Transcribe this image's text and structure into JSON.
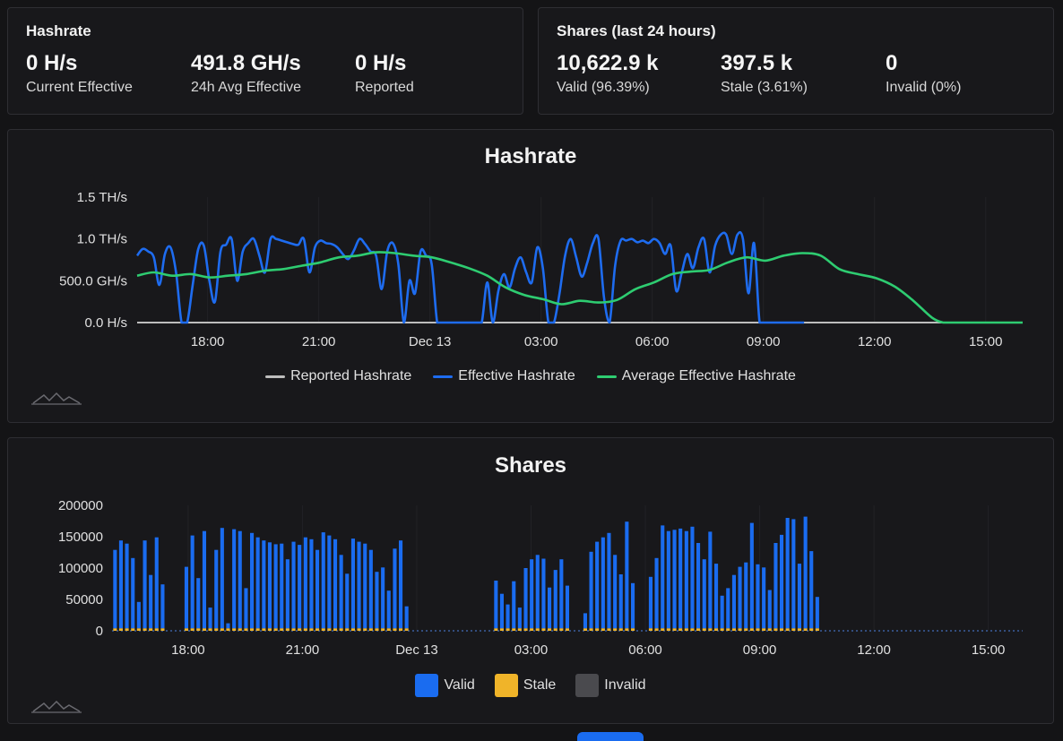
{
  "hashrate_card": {
    "title": "Hashrate",
    "stats": [
      {
        "value": "0 H/s",
        "label": "Current Effective"
      },
      {
        "value": "491.8 GH/s",
        "label": "24h Avg Effective"
      },
      {
        "value": "0 H/s",
        "label": "Reported"
      }
    ]
  },
  "shares_card": {
    "title": "Shares (last 24 hours)",
    "stats": [
      {
        "value": "10,622.9 k",
        "label": "Valid (96.39%)"
      },
      {
        "value": "397.5 k",
        "label": "Stale (3.61%)"
      },
      {
        "value": "0",
        "label": "Invalid (0%)"
      }
    ]
  },
  "colors": {
    "effective": "#1e6cf0",
    "average": "#2ecc71",
    "reported": "#bdbdbd",
    "valid": "#1a6cf0",
    "stale": "#f0b429",
    "invalid": "#4a4a4e"
  },
  "icons": {
    "watermark": "chart-logo-icon"
  },
  "chart_data": [
    {
      "type": "line",
      "title": "Hashrate",
      "x_ticks": [
        "18:00",
        "21:00",
        "Dec 13",
        "03:00",
        "06:00",
        "09:00",
        "12:00",
        "15:00"
      ],
      "x_tick_hours": [
        18,
        21,
        24,
        27,
        30,
        33,
        36,
        39
      ],
      "x_range_hours": [
        16.05,
        39.95
      ],
      "y_ticks": [
        "0.0 H/s",
        "500.0 GH/s",
        "1.0 TH/s",
        "1.5 TH/s"
      ],
      "y_tick_values_ghs": [
        0,
        500,
        1000,
        1500
      ],
      "ylim_ghs": [
        0,
        1500
      ],
      "grid": true,
      "legend": "bottom",
      "series": [
        {
          "name": "Reported Hashrate",
          "color_key": "reported",
          "hours": [
            16.05,
            39.95
          ],
          "values_ghs": [
            0,
            0
          ]
        },
        {
          "name": "Effective Hashrate",
          "color_key": "effective",
          "hours": [
            16.05,
            16.2,
            16.35,
            16.5,
            16.65,
            16.8,
            16.95,
            17.1,
            17.25,
            17.4,
            17.55,
            17.7,
            17.85,
            18.0,
            18.15,
            18.3,
            18.45,
            18.6,
            18.75,
            18.9,
            19.05,
            19.2,
            19.35,
            19.5,
            19.65,
            19.8,
            19.95,
            20.1,
            20.25,
            20.4,
            20.55,
            20.7,
            20.85,
            21.0,
            21.15,
            21.3,
            21.45,
            21.6,
            21.75,
            21.9,
            22.05,
            22.2,
            22.35,
            22.5,
            22.65,
            22.8,
            22.95,
            23.1,
            23.25,
            23.4,
            23.55,
            23.7,
            23.85,
            24.0,
            24.15,
            24.3,
            24.45,
            24.6,
            24.75,
            24.9,
            25.05,
            25.2,
            25.35,
            25.5,
            25.65,
            25.8,
            25.95,
            26.1,
            26.25,
            26.4,
            26.55,
            26.7,
            26.85,
            27.0,
            27.15,
            27.3,
            27.45,
            27.6,
            27.75,
            27.9,
            28.05,
            28.2,
            28.35,
            28.5,
            28.65,
            28.8,
            28.95,
            29.1,
            29.25,
            29.4,
            29.55,
            29.7,
            29.85,
            30.0,
            30.15,
            30.3,
            30.45,
            30.6,
            30.75,
            30.9,
            31.05,
            31.2,
            31.35,
            31.5,
            31.65,
            31.8,
            31.95,
            32.1,
            32.25,
            32.4,
            32.55,
            32.7,
            32.85,
            33.0,
            33.15,
            33.3,
            33.45,
            33.6,
            33.75,
            33.9,
            34.05,
            34.2,
            34.35,
            34.5,
            35.0,
            36.0,
            37.0,
            38.0,
            39.0,
            39.95
          ],
          "values_ghs": [
            800,
            880,
            850,
            780,
            450,
            820,
            900,
            600,
            0,
            0,
            450,
            880,
            920,
            500,
            250,
            850,
            930,
            1000,
            500,
            850,
            950,
            1000,
            800,
            600,
            1000,
            1000,
            980,
            960,
            940,
            930,
            1000,
            600,
            900,
            980,
            950,
            940,
            900,
            820,
            760,
            860,
            1000,
            940,
            850,
            800,
            400,
            850,
            950,
            700,
            0,
            500,
            350,
            850,
            800,
            700,
            0,
            0,
            0,
            0,
            0,
            0,
            0,
            0,
            0,
            480,
            0,
            380,
            580,
            420,
            650,
            780,
            600,
            480,
            900,
            650,
            0,
            0,
            350,
            800,
            1000,
            780,
            550,
            720,
            950,
            1000,
            300,
            0,
            680,
            980,
            980,
            1000,
            960,
            980,
            950,
            1000,
            950,
            820,
            920,
            380,
            600,
            820,
            650,
            900,
            1000,
            600,
            920,
            1050,
            1050,
            820,
            1050,
            1000,
            350,
            950,
            0,
            0,
            0,
            0,
            0,
            0,
            0,
            0,
            0,
            0
          ]
        },
        {
          "name": "Average Effective Hashrate",
          "color_key": "average",
          "hours": [
            16.05,
            16.5,
            17.0,
            17.5,
            18.0,
            18.5,
            19.0,
            19.5,
            20.0,
            20.5,
            21.0,
            21.5,
            22.0,
            22.5,
            23.0,
            23.5,
            24.0,
            24.5,
            25.0,
            25.5,
            26.0,
            26.5,
            27.0,
            27.5,
            28.0,
            28.5,
            29.0,
            29.5,
            30.0,
            30.5,
            31.0,
            31.5,
            32.0,
            32.5,
            33.0,
            33.5,
            34.0,
            34.5,
            35.0,
            35.5,
            36.0,
            36.5,
            37.0,
            37.5,
            37.8,
            38.0,
            38.5,
            39.0,
            39.95
          ],
          "values_ghs": [
            560,
            600,
            560,
            580,
            540,
            560,
            580,
            620,
            640,
            680,
            720,
            780,
            800,
            840,
            830,
            800,
            780,
            720,
            650,
            560,
            420,
            330,
            280,
            220,
            260,
            240,
            270,
            400,
            480,
            580,
            610,
            630,
            720,
            780,
            740,
            800,
            830,
            800,
            640,
            580,
            530,
            430,
            260,
            60,
            0,
            0,
            0,
            0,
            0
          ]
        }
      ]
    },
    {
      "type": "bar",
      "title": "Shares",
      "stacked": true,
      "x_ticks": [
        "18:00",
        "21:00",
        "Dec 13",
        "03:00",
        "06:00",
        "09:00",
        "12:00",
        "15:00"
      ],
      "x_tick_hours": [
        18,
        21,
        24,
        27,
        30,
        33,
        36,
        39
      ],
      "x_range_hours": [
        16.05,
        39.95
      ],
      "y_ticks": [
        "0",
        "50000",
        "100000",
        "150000",
        "200000"
      ],
      "y_tick_values": [
        0,
        50000,
        100000,
        150000,
        200000
      ],
      "ylim": [
        0,
        200000
      ],
      "grid": true,
      "legend": "bottom",
      "bar_interval_hours": 0.1667,
      "bar_start_hour": 16.05,
      "series": [
        {
          "name": "Valid",
          "color_key": "valid",
          "values": [
            125000,
            140000,
            135000,
            112000,
            42000,
            140000,
            85000,
            145000,
            70000,
            0,
            0,
            0,
            98000,
            148000,
            80000,
            155000,
            33000,
            125000,
            160000,
            8000,
            158000,
            155000,
            64000,
            152000,
            145000,
            140000,
            137000,
            134000,
            135000,
            110000,
            138000,
            133000,
            145000,
            142000,
            125000,
            153000,
            148000,
            142000,
            117000,
            87000,
            143000,
            138000,
            135000,
            125000,
            90000,
            97000,
            60000,
            127000,
            140000,
            35000,
            0,
            0,
            0,
            0,
            0,
            0,
            0,
            0,
            0,
            0,
            0,
            0,
            0,
            0,
            76000,
            55000,
            38000,
            75000,
            33000,
            96000,
            110000,
            117000,
            111000,
            65000,
            93000,
            110000,
            68000,
            0,
            0,
            24000,
            122000,
            138000,
            145000,
            152000,
            117000,
            86000,
            170000,
            72000,
            0,
            0,
            82000,
            112000,
            164000,
            155000,
            157000,
            159000,
            155000,
            162000,
            136000,
            110000,
            154000,
            103000,
            52000,
            64000,
            85000,
            98000,
            105000,
            168000,
            102000,
            97000,
            61000,
            136000,
            149000,
            176000,
            174000,
            103000,
            178000,
            123000,
            50000,
            0,
            0,
            0,
            0,
            0,
            0,
            0,
            0,
            0,
            0,
            0,
            0,
            0,
            0,
            0,
            0,
            0,
            0,
            0,
            0,
            0,
            0,
            0,
            0,
            0,
            0,
            0,
            0,
            0,
            0,
            0,
            0,
            0,
            0
          ],
          "note_values_truncated": false
        },
        {
          "name": "Stale",
          "color_key": "stale",
          "values_constant": 4000
        },
        {
          "name": "Invalid",
          "color_key": "invalid",
          "values_constant": 0
        }
      ]
    }
  ]
}
